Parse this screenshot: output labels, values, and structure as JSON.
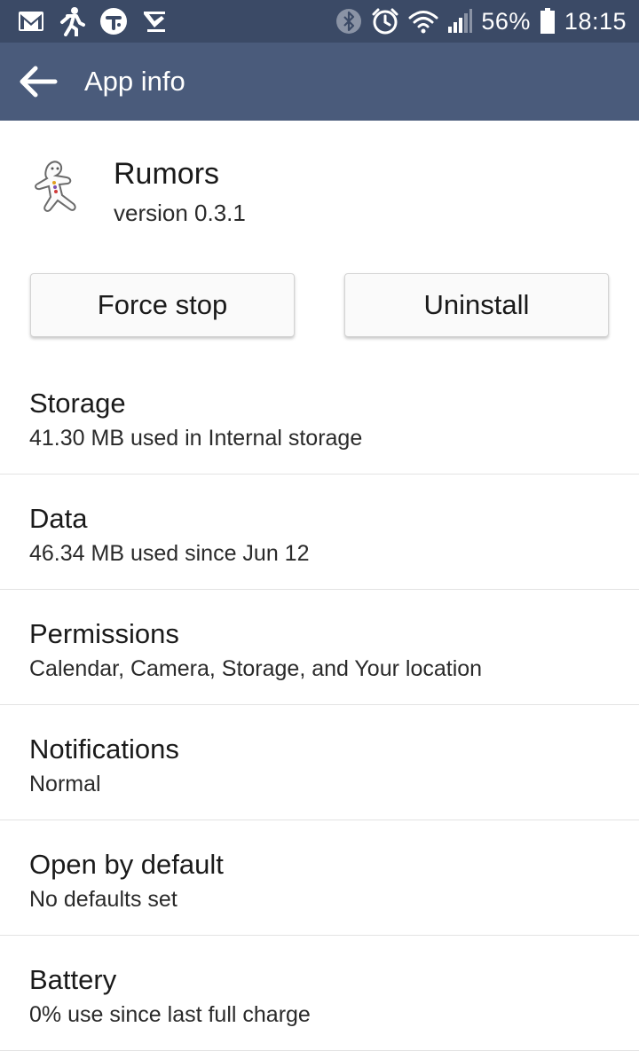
{
  "status_bar": {
    "battery_percent": "56%",
    "time": "18:15",
    "left_icons": [
      "gmail-icon",
      "activity-icon",
      "t-app-icon",
      "check-app-icon"
    ],
    "right_icons": [
      "bluetooth-icon",
      "alarm-icon",
      "wifi-icon",
      "signal-icon",
      "battery-icon"
    ],
    "background": "#3b4a66"
  },
  "app_bar": {
    "title": "App info",
    "background": "#4a5b7b"
  },
  "app": {
    "name": "Rumors",
    "version": "version 0.3.1",
    "icon": "gingerbread-man-icon"
  },
  "buttons": {
    "force_stop": "Force stop",
    "uninstall": "Uninstall"
  },
  "settings": [
    {
      "title": "Storage",
      "subtitle": "41.30 MB used in Internal storage"
    },
    {
      "title": "Data",
      "subtitle": "46.34 MB used since Jun 12"
    },
    {
      "title": "Permissions",
      "subtitle": "Calendar, Camera, Storage, and Your location"
    },
    {
      "title": "Notifications",
      "subtitle": "Normal"
    },
    {
      "title": "Open by default",
      "subtitle": "No defaults set"
    },
    {
      "title": "Battery",
      "subtitle": "0% use since last full charge"
    }
  ]
}
